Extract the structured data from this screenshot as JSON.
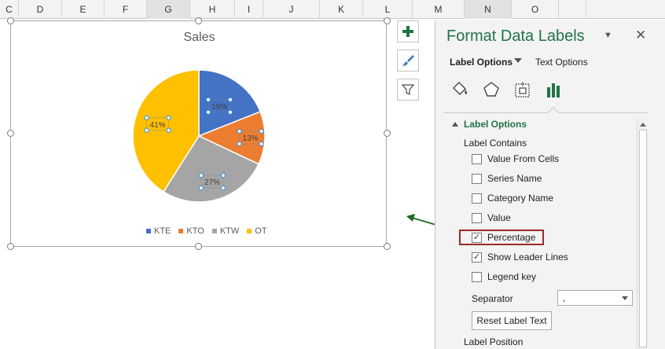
{
  "columns": [
    {
      "label": "C",
      "w": 24
    },
    {
      "label": "D",
      "w": 55
    },
    {
      "label": "E",
      "w": 54
    },
    {
      "label": "F",
      "w": 54
    },
    {
      "label": "G",
      "w": 55
    },
    {
      "label": "H",
      "w": 57
    },
    {
      "label": "I",
      "w": 36
    },
    {
      "label": "J",
      "w": 72
    },
    {
      "label": "K",
      "w": 55
    },
    {
      "label": "L",
      "w": 63
    },
    {
      "label": "M",
      "w": 66
    },
    {
      "label": "N",
      "w": 60
    },
    {
      "label": "O",
      "w": 60
    },
    {
      "label": "",
      "w": 35
    }
  ],
  "chart_data": {
    "type": "pie",
    "title": "Sales",
    "categories": [
      "KTE",
      "KTO",
      "KTW",
      "OT"
    ],
    "values": [
      19,
      13,
      27,
      41
    ],
    "data_labels": [
      "19%",
      "13%",
      "27%",
      "41%"
    ],
    "colors": [
      "#4472c4",
      "#ed7d31",
      "#a5a5a5",
      "#ffc000"
    ],
    "legend_position": "bottom"
  },
  "pane": {
    "title": "Format Data Labels",
    "dropdown_glyph": "▼",
    "close_glyph": "✕",
    "tab_label_options": "Label Options",
    "tab_text_options": "Text Options",
    "section": "Label Options",
    "label_contains": "Label Contains",
    "checkboxes": [
      {
        "label": "Value From Cells",
        "checked": false
      },
      {
        "label": "Series Name",
        "checked": false
      },
      {
        "label": "Category Name",
        "checked": false
      },
      {
        "label": "Value",
        "checked": false
      },
      {
        "label": "Percentage",
        "checked": true
      },
      {
        "label": "Show Leader Lines",
        "checked": true
      },
      {
        "label": "Legend key",
        "checked": false
      }
    ],
    "separator_label": "Separator",
    "separator_value": ",",
    "reset_button": "Reset Label Text",
    "label_position": "Label Position"
  },
  "colors": {
    "accent": "#217346",
    "highlight_border": "#9b2a2a",
    "arrow": "#1e6b1e"
  }
}
